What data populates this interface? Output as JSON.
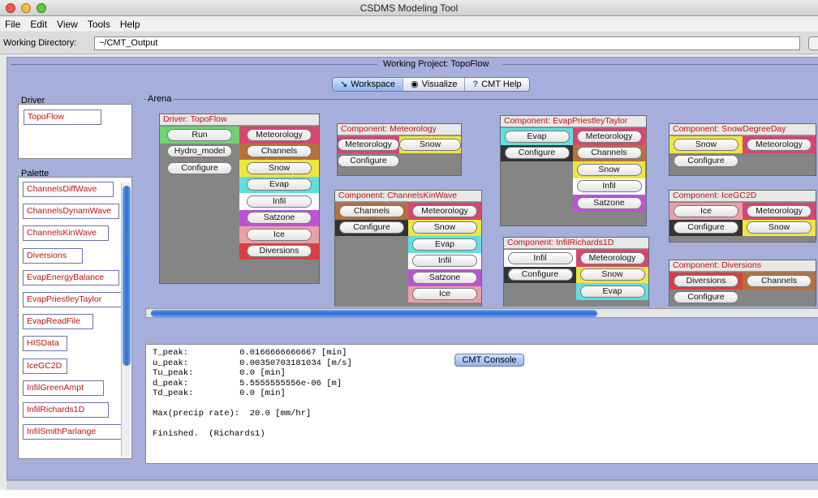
{
  "window": {
    "title": "CSDMS Modeling Tool"
  },
  "menu": [
    "File",
    "Edit",
    "View",
    "Tools",
    "Help"
  ],
  "working_directory": {
    "label": "Working Directory:",
    "value": "~/CMT_Output"
  },
  "project": {
    "title": "Working Project: TopoFlow"
  },
  "tabs": [
    {
      "label": "Workspace",
      "icon": "arrow-icon"
    },
    {
      "label": "Visualize",
      "icon": "eye-icon"
    },
    {
      "label": "CMT Help",
      "icon": "question-icon"
    }
  ],
  "driver": {
    "label": "Driver",
    "item": "TopoFlow"
  },
  "palette": {
    "label": "Palette",
    "items": [
      "ChannelsDiffWave",
      "ChannelsDynamWave",
      "ChannelsKinWave",
      "Diversions",
      "EvapEnergyBalance",
      "EvapPriestleyTaylor",
      "EvapReadFile",
      "HISData",
      "IceGC2D",
      "InfilGreenAmpt",
      "InfilRichards1D",
      "InfilSmithParlange"
    ]
  },
  "arena": {
    "label": "Arena"
  },
  "components": [
    {
      "title": "Driver: TopoFlow",
      "left": [
        {
          "label": "Run",
          "color": "#6fd36f"
        },
        {
          "label": "Hydro_model",
          "color": "#858585"
        },
        {
          "label": "Configure",
          "color": "#858585"
        }
      ],
      "right": [
        {
          "label": "Meteorology",
          "color": "#d94470"
        },
        {
          "label": "Channels",
          "color": "#b8703a"
        },
        {
          "label": "Snow",
          "color": "#f0e640"
        },
        {
          "label": "Evap",
          "color": "#5fe0e0"
        },
        {
          "label": "Infil",
          "color": "#ffffff"
        },
        {
          "label": "Satzone",
          "color": "#c050d8"
        },
        {
          "label": "Ice",
          "color": "#e8a0a8"
        },
        {
          "label": "Diversions",
          "color": "#d84040"
        }
      ]
    },
    {
      "title": "Component: Meteorology",
      "left": [
        {
          "label": "Meteorology",
          "color": "#d94470"
        },
        {
          "label": "Configure",
          "color": "#858585"
        }
      ],
      "right": [
        {
          "label": "Snow",
          "color": "#f0e640"
        }
      ]
    },
    {
      "title": "Component: ChannelsKinWave",
      "left": [
        {
          "label": "Channels",
          "color": "#b8703a"
        },
        {
          "label": "Configure",
          "color": "#333333"
        }
      ],
      "right": [
        {
          "label": "Meteorology",
          "color": "#d94470"
        },
        {
          "label": "Snow",
          "color": "#f0e640"
        },
        {
          "label": "Evap",
          "color": "#5fe0e0"
        },
        {
          "label": "Infil",
          "color": "#ffffff"
        },
        {
          "label": "Satzone",
          "color": "#c050d8"
        },
        {
          "label": "Ice",
          "color": "#e8a0a8"
        }
      ]
    },
    {
      "title": "Component: EvapPriestleyTaylor",
      "left": [
        {
          "label": "Evap",
          "color": "#5fe0e0"
        },
        {
          "label": "Configure",
          "color": "#333333"
        }
      ],
      "right": [
        {
          "label": "Meteorology",
          "color": "#d94470"
        },
        {
          "label": "Channels",
          "color": "#b8703a"
        },
        {
          "label": "Snow",
          "color": "#f0e640"
        },
        {
          "label": "Infil",
          "color": "#ffffff"
        },
        {
          "label": "Satzone",
          "color": "#c050d8"
        }
      ]
    },
    {
      "title": "Component: InfilRichards1D",
      "left": [
        {
          "label": "Infil",
          "color": "#ffffff"
        },
        {
          "label": "Configure",
          "color": "#333333"
        }
      ],
      "right": [
        {
          "label": "Meteorology",
          "color": "#d94470"
        },
        {
          "label": "Snow",
          "color": "#f0e640"
        },
        {
          "label": "Evap",
          "color": "#5fe0e0"
        }
      ]
    },
    {
      "title": "Component: SnowDegreeDay",
      "left": [
        {
          "label": "Snow",
          "color": "#f0e640"
        },
        {
          "label": "Configure",
          "color": "#858585"
        }
      ],
      "right": [
        {
          "label": "Meteorology",
          "color": "#d94470"
        }
      ]
    },
    {
      "title": "Component: IceGC2D",
      "left": [
        {
          "label": "Ice",
          "color": "#e8a0a8"
        },
        {
          "label": "Configure",
          "color": "#333333"
        }
      ],
      "right": [
        {
          "label": "Meteorology",
          "color": "#d94470"
        },
        {
          "label": "Snow",
          "color": "#f0e640"
        }
      ]
    },
    {
      "title": "Component: Diversions",
      "left": [
        {
          "label": "Diversions",
          "color": "#d84040"
        },
        {
          "label": "Configure",
          "color": "#858585"
        }
      ],
      "right": [
        {
          "label": "Channels",
          "color": "#b8703a"
        }
      ]
    }
  ],
  "console": {
    "label": "CMT Console",
    "lines": [
      "T_peak:          0.0166666666667 [min]",
      "u_peak:          0.00350703181034 [m/s]",
      "Tu_peak:         0.0 [min]",
      "d_peak:          5.5555555556e-06 [m]",
      "Td_peak:         0.0 [min]",
      "",
      "Max(precip rate):  20.0 [mm/hr]",
      "",
      "Finished.  (Richards1)"
    ]
  },
  "colors": {
    "panel_bg": "#a6aedc",
    "label_red": "#c01010"
  }
}
